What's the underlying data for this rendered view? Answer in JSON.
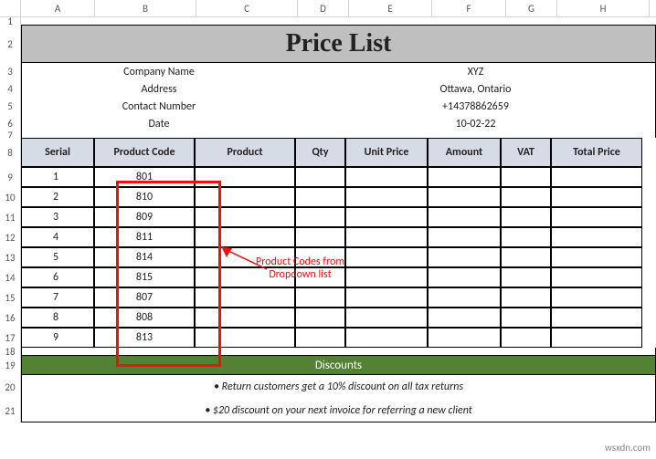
{
  "cols": [
    "A",
    "B",
    "C",
    "D",
    "E",
    "F",
    "G",
    "H"
  ],
  "rownums": [
    "1",
    "2",
    "3",
    "4",
    "5",
    "6",
    "7",
    "8",
    "9",
    "10",
    "11",
    "12",
    "13",
    "14",
    "15",
    "16",
    "17",
    "18",
    "19",
    "20",
    "21"
  ],
  "title": "Price List",
  "meta": {
    "company_k": "Company Name",
    "company_v": "XYZ",
    "address_k": "Address",
    "address_v": "Ottawa, Ontario",
    "contact_k": "Contact Number",
    "contact_v": "+14378862659",
    "date_k": "Date",
    "date_v": "10-02-22"
  },
  "headers": {
    "serial": "Serial",
    "pcode": "Product Code",
    "product": "Product",
    "qty": "Qty",
    "unit": "Unit Price",
    "amount": "Amount",
    "vat": "VAT",
    "total": "Total Price"
  },
  "data": [
    {
      "serial": "1",
      "pcode": "801"
    },
    {
      "serial": "2",
      "pcode": "810"
    },
    {
      "serial": "3",
      "pcode": "809"
    },
    {
      "serial": "4",
      "pcode": "811"
    },
    {
      "serial": "5",
      "pcode": "814"
    },
    {
      "serial": "6",
      "pcode": "815"
    },
    {
      "serial": "7",
      "pcode": "807"
    },
    {
      "serial": "8",
      "pcode": "808"
    },
    {
      "serial": "9",
      "pcode": "813"
    }
  ],
  "discounts_header": "Discounts",
  "note1": "• Return customers get a 10% discount on all tax returns",
  "note2": "• $20 discount on your next invoice for referring a new client",
  "callout_l1": "Product Codes from",
  "callout_l2": "Dropdown list",
  "watermark": "wsxdn.com"
}
